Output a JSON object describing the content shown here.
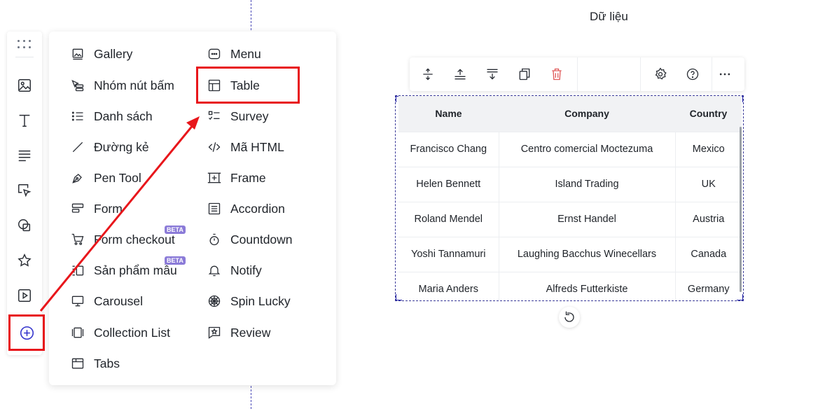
{
  "colors": {
    "accent": "#3333cc",
    "highlight": "#e8161b",
    "delete": "#e05a5a",
    "beta": "#8b7bd8"
  },
  "toolbar": {
    "icons": [
      "drag-handle-icon",
      "image-icon",
      "text-icon",
      "paragraph-icon",
      "cursor-select-icon",
      "shapes-icon",
      "star-icon",
      "video-icon",
      "add-circle-icon"
    ]
  },
  "menu": {
    "left": [
      {
        "label": "Gallery",
        "icon": "gallery-icon"
      },
      {
        "label": "Nhóm nút bấm",
        "icon": "button-group-icon"
      },
      {
        "label": "Danh sách",
        "icon": "list-icon"
      },
      {
        "label": "Đường kẻ",
        "icon": "line-icon"
      },
      {
        "label": "Pen Tool",
        "icon": "pen-tool-icon"
      },
      {
        "label": "Form",
        "icon": "form-icon"
      },
      {
        "label": "Form checkout",
        "icon": "cart-icon",
        "badge": "BETA"
      },
      {
        "label": "Sản phẩm mẫu",
        "icon": "product-icon",
        "badge": "BETA"
      },
      {
        "label": "Carousel",
        "icon": "carousel-icon"
      },
      {
        "label": "Collection List",
        "icon": "collection-list-icon"
      },
      {
        "label": "Tabs",
        "icon": "tabs-icon"
      }
    ],
    "right": [
      {
        "label": "Menu",
        "icon": "menu-icon"
      },
      {
        "label": "Table",
        "icon": "table-icon"
      },
      {
        "label": "Survey",
        "icon": "survey-icon"
      },
      {
        "label": "Mã HTML",
        "icon": "code-icon"
      },
      {
        "label": "Frame",
        "icon": "frame-icon"
      },
      {
        "label": "Accordion",
        "icon": "accordion-icon"
      },
      {
        "label": "Countdown",
        "icon": "countdown-icon"
      },
      {
        "label": "Notify",
        "icon": "bell-icon"
      },
      {
        "label": "Spin Lucky",
        "icon": "spin-wheel-icon"
      },
      {
        "label": "Review",
        "icon": "review-icon"
      }
    ]
  },
  "element_toolbar": {
    "data_label": "Dữ liệu",
    "icons": [
      "row-height-icon",
      "insert-row-above-icon",
      "insert-row-below-icon",
      "duplicate-icon",
      "delete-icon",
      "settings-icon",
      "help-icon",
      "more-icon"
    ]
  },
  "table": {
    "headers": [
      "Name",
      "Company",
      "Country"
    ],
    "rows": [
      [
        "Francisco Chang",
        "Centro comercial Moctezuma",
        "Mexico"
      ],
      [
        "Helen Bennett",
        "Island Trading",
        "UK"
      ],
      [
        "Roland Mendel",
        "Ernst Handel",
        "Austria"
      ],
      [
        "Yoshi Tannamuri",
        "Laughing Bacchus Winecellars",
        "Canada"
      ],
      [
        "Maria Anders",
        "Alfreds Futterkiste",
        "Germany"
      ]
    ]
  }
}
